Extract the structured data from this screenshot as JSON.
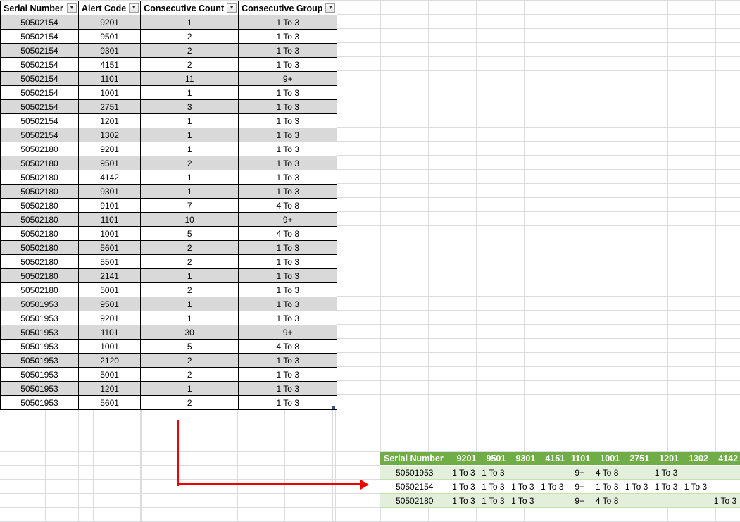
{
  "source_table": {
    "headers": [
      "Serial Number",
      "Alert Code",
      "Consecutive Count",
      "Consecutive Group"
    ],
    "rows": [
      [
        "50502154",
        "9201",
        "1",
        "1 To 3"
      ],
      [
        "50502154",
        "9501",
        "2",
        "1 To 3"
      ],
      [
        "50502154",
        "9301",
        "2",
        "1 To 3"
      ],
      [
        "50502154",
        "4151",
        "2",
        "1 To 3"
      ],
      [
        "50502154",
        "1101",
        "11",
        "9+"
      ],
      [
        "50502154",
        "1001",
        "1",
        "1 To 3"
      ],
      [
        "50502154",
        "2751",
        "3",
        "1 To 3"
      ],
      [
        "50502154",
        "1201",
        "1",
        "1 To 3"
      ],
      [
        "50502154",
        "1302",
        "1",
        "1 To 3"
      ],
      [
        "50502180",
        "9201",
        "1",
        "1 To 3"
      ],
      [
        "50502180",
        "9501",
        "2",
        "1 To 3"
      ],
      [
        "50502180",
        "4142",
        "1",
        "1 To 3"
      ],
      [
        "50502180",
        "9301",
        "1",
        "1 To 3"
      ],
      [
        "50502180",
        "9101",
        "7",
        "4 To 8"
      ],
      [
        "50502180",
        "1101",
        "10",
        "9+"
      ],
      [
        "50502180",
        "1001",
        "5",
        "4 To 8"
      ],
      [
        "50502180",
        "5601",
        "2",
        "1 To 3"
      ],
      [
        "50502180",
        "5501",
        "2",
        "1 To 3"
      ],
      [
        "50502180",
        "2141",
        "1",
        "1 To 3"
      ],
      [
        "50502180",
        "5001",
        "2",
        "1 To 3"
      ],
      [
        "50501953",
        "9501",
        "1",
        "1 To 3"
      ],
      [
        "50501953",
        "9201",
        "1",
        "1 To 3"
      ],
      [
        "50501953",
        "1101",
        "30",
        "9+"
      ],
      [
        "50501953",
        "1001",
        "5",
        "4 To 8"
      ],
      [
        "50501953",
        "2120",
        "2",
        "1 To 3"
      ],
      [
        "50501953",
        "5001",
        "2",
        "1 To 3"
      ],
      [
        "50501953",
        "1201",
        "1",
        "1 To 3"
      ],
      [
        "50501953",
        "5601",
        "2",
        "1 To 3"
      ]
    ]
  },
  "pivot_table": {
    "headers": [
      "Serial Number",
      "9201",
      "9501",
      "9301",
      "4151",
      "1101",
      "1001",
      "2751",
      "1201",
      "1302",
      "4142"
    ],
    "rows": [
      [
        "50501953",
        "1 To 3",
        "1 To 3",
        "",
        "",
        "9+",
        "4 To 8",
        "",
        "1 To 3",
        "",
        ""
      ],
      [
        "50502154",
        "1 To 3",
        "1 To 3",
        "1 To 3",
        "1 To 3",
        "9+",
        "1 To 3",
        "1 To 3",
        "1 To 3",
        "1 To 3",
        ""
      ],
      [
        "50502180",
        "1 To 3",
        "1 To 3",
        "1 To 3",
        "",
        "9+",
        "4 To 8",
        "",
        "",
        "",
        "1 To 3"
      ]
    ]
  },
  "colors": {
    "pivot_header": "#70ad47",
    "pivot_band": "#e2efda",
    "source_band": "#d9d9d9",
    "arrow": "#e00000"
  },
  "icons": {
    "filter_dropdown": "chevron-down-icon"
  }
}
